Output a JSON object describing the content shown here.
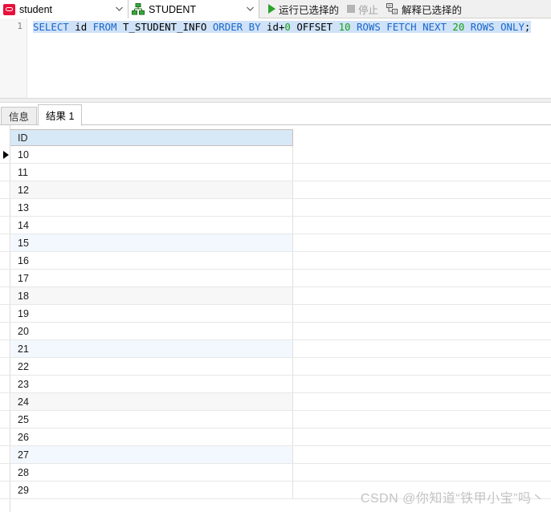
{
  "toolbar": {
    "connection": {
      "icon": "oracle-connection-icon",
      "value": "student",
      "arrow": "⌄"
    },
    "schema": {
      "icon": "schema-tree-icon",
      "value": "STUDENT",
      "arrow": "⌄"
    },
    "actions": [
      {
        "name": "run-selected-button",
        "icon": "play-icon",
        "label": "运行已选择的",
        "enabled": true
      },
      {
        "name": "stop-button",
        "icon": "stop-icon",
        "label": "停止",
        "enabled": false
      },
      {
        "name": "explain-selected-button",
        "icon": "explain-plan-icon",
        "label": "解释已选择的",
        "enabled": true
      }
    ]
  },
  "editor": {
    "line_number": "1",
    "sql_text": "SELECT id FROM T_STUDENT_INFO ORDER BY id+0 OFFSET 10 ROWS FETCH NEXT 20 ROWS ONLY;",
    "sql_tokens": [
      {
        "t": "SELECT",
        "c": "kw"
      },
      {
        "t": " ",
        "c": "pun"
      },
      {
        "t": "id",
        "c": "idn"
      },
      {
        "t": " ",
        "c": "pun"
      },
      {
        "t": "FROM",
        "c": "kw"
      },
      {
        "t": " ",
        "c": "pun"
      },
      {
        "t": "T_STUDENT_INFO",
        "c": "idn"
      },
      {
        "t": " ",
        "c": "pun"
      },
      {
        "t": "ORDER",
        "c": "kw"
      },
      {
        "t": " ",
        "c": "pun"
      },
      {
        "t": "BY",
        "c": "kw"
      },
      {
        "t": " ",
        "c": "pun"
      },
      {
        "t": "id",
        "c": "idn"
      },
      {
        "t": "+",
        "c": "pun"
      },
      {
        "t": "0",
        "c": "num"
      },
      {
        "t": " ",
        "c": "pun"
      },
      {
        "t": "OFFSET",
        "c": "idn"
      },
      {
        "t": " ",
        "c": "pun"
      },
      {
        "t": "10",
        "c": "num"
      },
      {
        "t": " ",
        "c": "pun"
      },
      {
        "t": "ROWS",
        "c": "kw"
      },
      {
        "t": " ",
        "c": "pun"
      },
      {
        "t": "FETCH",
        "c": "kw"
      },
      {
        "t": " ",
        "c": "pun"
      },
      {
        "t": "NEXT",
        "c": "kw"
      },
      {
        "t": " ",
        "c": "pun"
      },
      {
        "t": "20",
        "c": "num"
      },
      {
        "t": " ",
        "c": "pun"
      },
      {
        "t": "ROWS",
        "c": "kw"
      },
      {
        "t": " ",
        "c": "pun"
      },
      {
        "t": "ONLY",
        "c": "kw"
      },
      {
        "t": ";",
        "c": "pun"
      }
    ],
    "selection_color": "#cfe2f7",
    "keyword_color": "#1a66cc",
    "number_color": "#16a016"
  },
  "result_panel": {
    "tabs": [
      {
        "name": "tab-info",
        "label": "信息",
        "active": false
      },
      {
        "name": "tab-result",
        "label": "结果 1",
        "active": true
      }
    ],
    "grid": {
      "columns": [
        "ID"
      ],
      "header_color": "#d7e8f6",
      "current_row_index": 0,
      "rows": [
        {
          "ID": "10",
          "tint": "none"
        },
        {
          "ID": "11",
          "tint": "none"
        },
        {
          "ID": "12",
          "tint": "grey"
        },
        {
          "ID": "13",
          "tint": "none"
        },
        {
          "ID": "14",
          "tint": "none"
        },
        {
          "ID": "15",
          "tint": "blue"
        },
        {
          "ID": "16",
          "tint": "none"
        },
        {
          "ID": "17",
          "tint": "none"
        },
        {
          "ID": "18",
          "tint": "grey"
        },
        {
          "ID": "19",
          "tint": "none"
        },
        {
          "ID": "20",
          "tint": "none"
        },
        {
          "ID": "21",
          "tint": "blue"
        },
        {
          "ID": "22",
          "tint": "none"
        },
        {
          "ID": "23",
          "tint": "none"
        },
        {
          "ID": "24",
          "tint": "grey"
        },
        {
          "ID": "25",
          "tint": "none"
        },
        {
          "ID": "26",
          "tint": "none"
        },
        {
          "ID": "27",
          "tint": "blue"
        },
        {
          "ID": "28",
          "tint": "none"
        },
        {
          "ID": "29",
          "tint": "none"
        }
      ]
    }
  },
  "watermark": {
    "text": "CSDN @你知道“铁甲小宝”吗丶"
  }
}
